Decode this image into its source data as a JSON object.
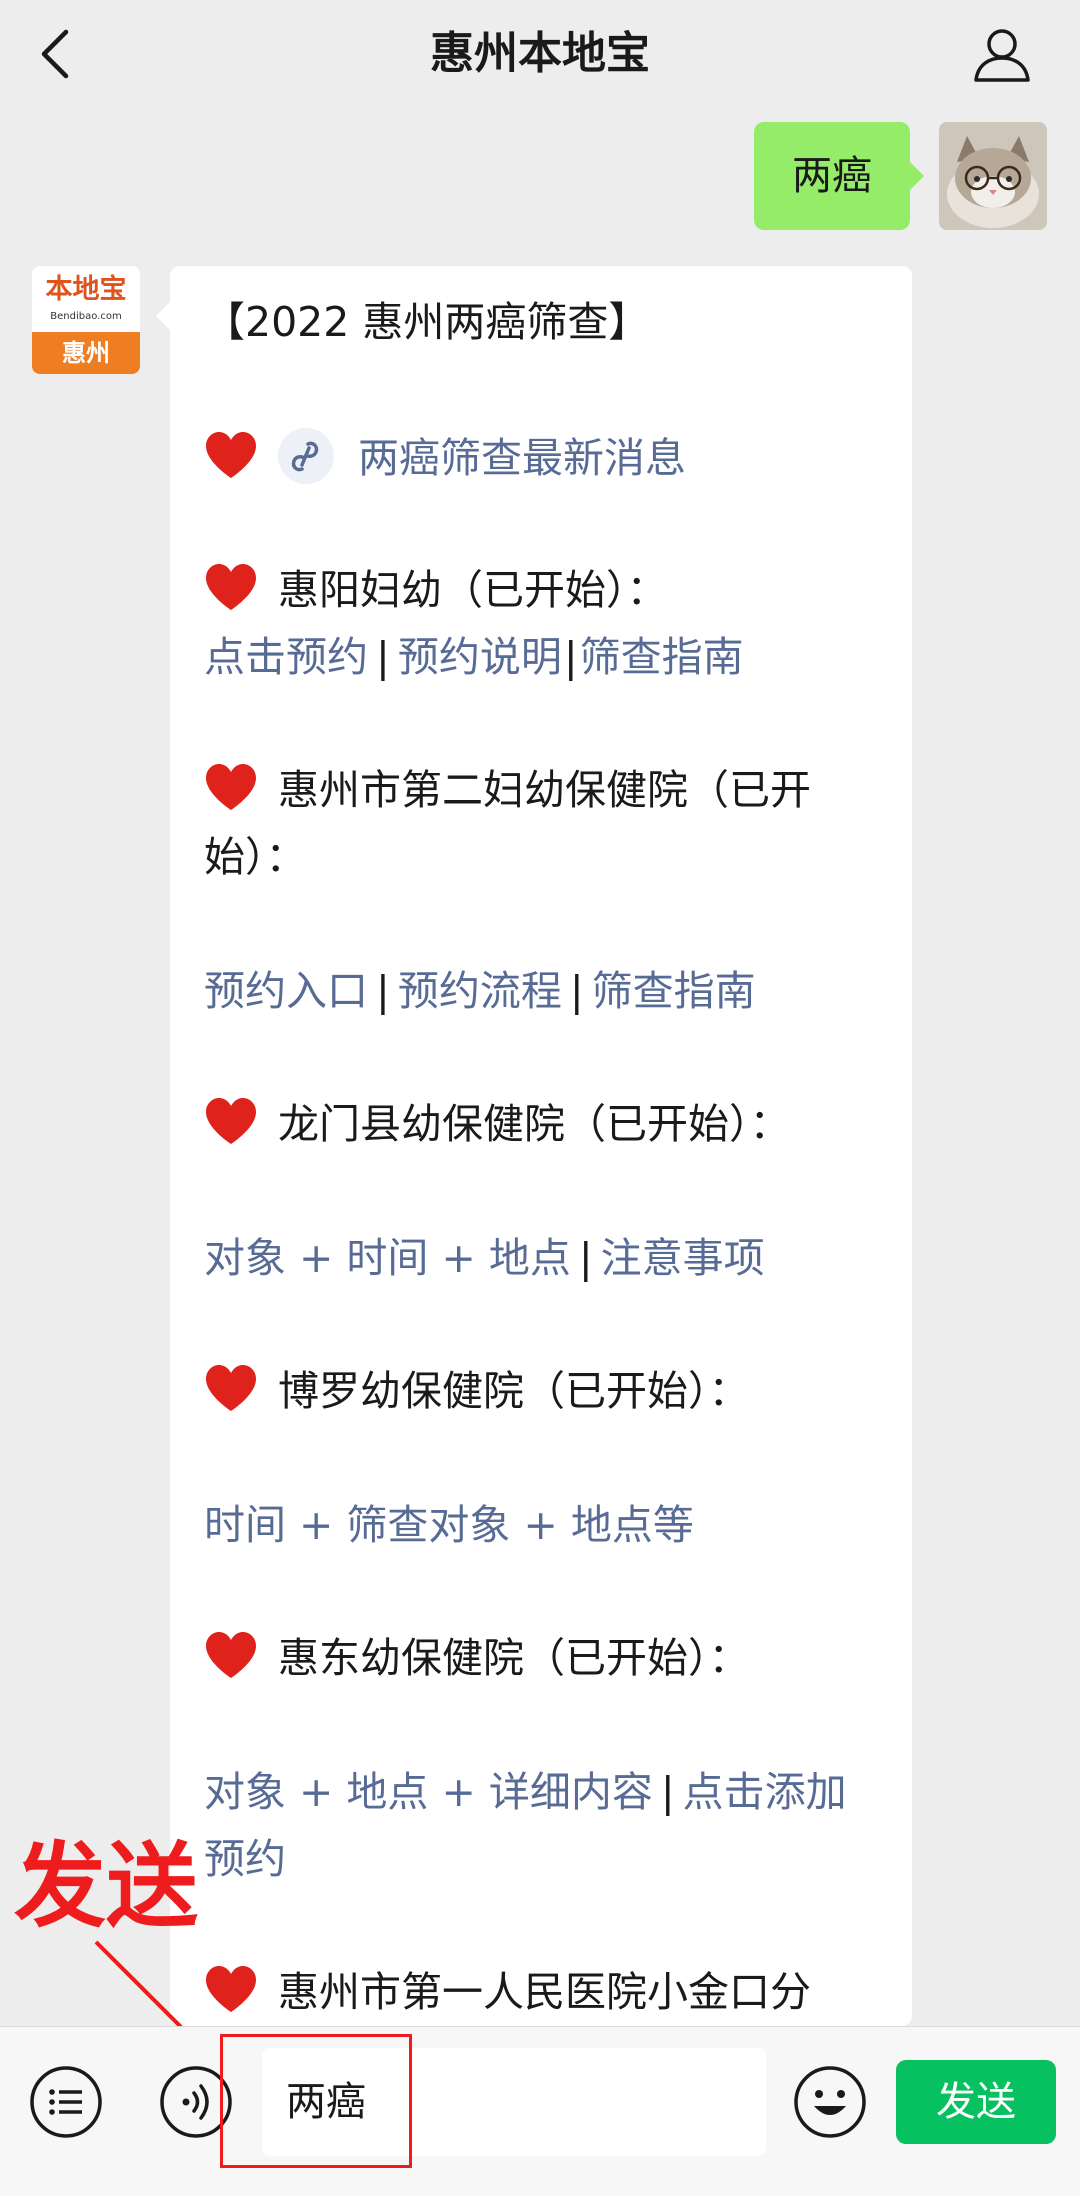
{
  "header": {
    "title": "惠州本地宝"
  },
  "user_message": {
    "text": "两癌"
  },
  "account_logo": {
    "main": "本地宝",
    "sub": "Bendibao.com",
    "city": "惠州"
  },
  "reply": {
    "heading": "【2022 惠州两癌筛查】",
    "mini_program_link": "两癌筛查最新消息",
    "sections": [
      {
        "title": "惠阳妇幼（已开始）：",
        "links": [
          "点击预约",
          "预约说明",
          "筛查指南"
        ]
      },
      {
        "title_line1": "惠州市第二妇幼保健院（已开",
        "title_line2": "始）：",
        "links": [
          "预约入口",
          "预约流程",
          "筛查指南"
        ]
      },
      {
        "title": "龙门县幼保健院（已开始）：",
        "links": [
          "对象 + 时间 + 地点",
          "注意事项"
        ]
      },
      {
        "title": "博罗幼保健院（已开始）：",
        "links": [
          "时间 + 筛查对象 + 地点等"
        ]
      },
      {
        "title": "惠东幼保健院（已开始）：",
        "links": [
          "对象 + 地点 + 详细内容",
          "点击添加",
          "预约"
        ]
      },
      {
        "title": "惠州市第一人民医院小金口分"
      }
    ]
  },
  "annotation": {
    "label": "发送",
    "color": "#ee1c1c"
  },
  "input_bar": {
    "value": "两癌",
    "send_label": "发送"
  },
  "colors": {
    "link": "#576b95",
    "user_bubble": "#95ec69",
    "send_button": "#07c160"
  },
  "icons": [
    "back-icon",
    "profile-icon",
    "heart-icon",
    "mini-program-icon",
    "menu-icon",
    "voice-icon",
    "emoji-icon"
  ]
}
